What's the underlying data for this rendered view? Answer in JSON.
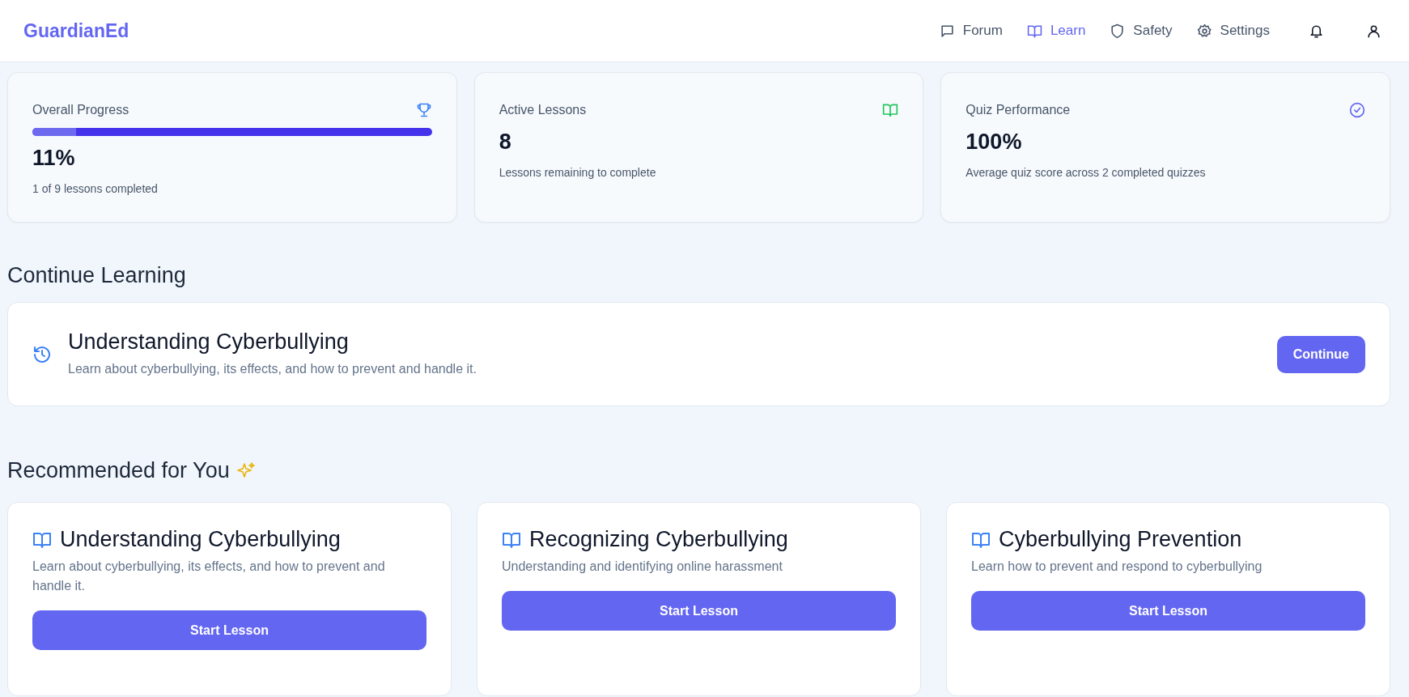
{
  "header": {
    "logo": "GuardianEd",
    "nav": [
      {
        "label": "Forum",
        "kind": "message",
        "selected": false
      },
      {
        "label": "Learn",
        "kind": "book",
        "selected": true
      },
      {
        "label": "Safety",
        "kind": "shield",
        "selected": false
      },
      {
        "label": "Settings",
        "kind": "gear",
        "selected": false
      }
    ]
  },
  "stats": [
    {
      "title": "Overall Progress",
      "kind": "trophy",
      "value": "11%",
      "caption": "1 of 9 lessons completed",
      "level": 0.11
    },
    {
      "title": "Active Lessons",
      "kind": "book",
      "value": "8",
      "caption": "Lessons remaining to complete"
    },
    {
      "title": "Quiz Performance",
      "kind": "check",
      "value": "100%",
      "caption": "Average quiz score across 2 completed quizzes"
    }
  ],
  "continue_section": {
    "heading": "Continue Learning",
    "title": "Understanding Cyberbullying",
    "description": "Learn about cyberbullying, its effects, and how to prevent and handle it.",
    "button": "Continue"
  },
  "recommended": {
    "heading": "Recommended for You",
    "lessons": [
      {
        "title": "Understanding Cyberbullying",
        "description": "Learn about cyberbullying, its effects, and how to prevent and handle it.",
        "button": "Start Lesson"
      },
      {
        "title": "Recognizing Cyberbullying",
        "description": "Understanding and identifying online harassment",
        "button": "Start Lesson"
      },
      {
        "title": "Cyberbullying Prevention",
        "description": "Learn how to prevent and respond to cyberbullying",
        "button": "Start Lesson"
      }
    ]
  }
}
